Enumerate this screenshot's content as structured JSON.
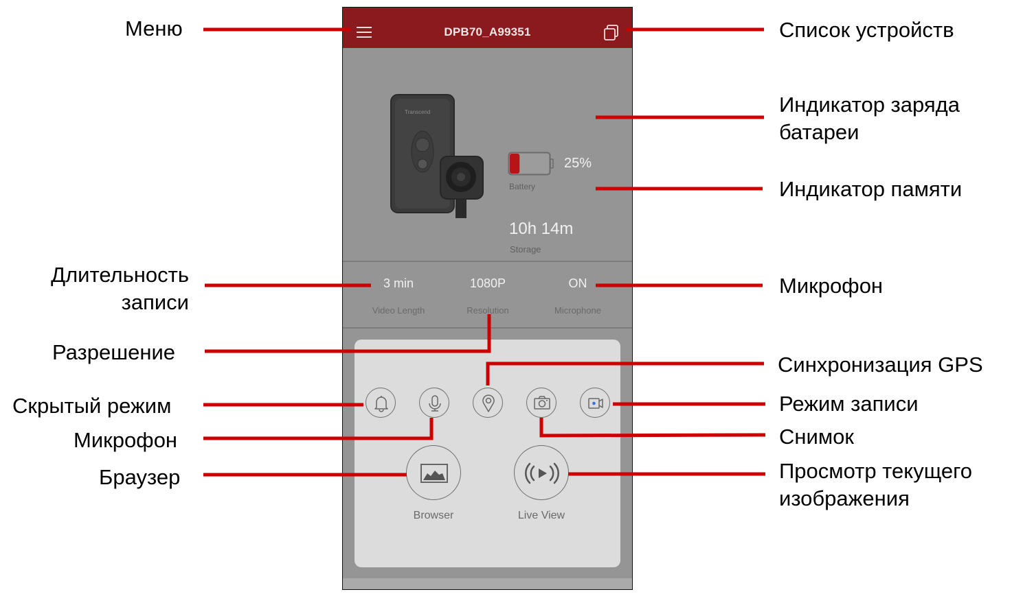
{
  "app": {
    "device_name": "DPB70_A99351",
    "accent_color": "#8b1a1e",
    "menu_icon": "hamburger-menu-icon",
    "device_list_icon": "device-list-icon"
  },
  "status": {
    "battery_percent": 25,
    "battery_text": "25%",
    "battery_label": "Battery",
    "battery_fill_color": "#b81418",
    "storage_value": "10h 14m",
    "storage_label": "Storage"
  },
  "settings": [
    {
      "value": "3 min",
      "label": "Video Length"
    },
    {
      "value": "1080P",
      "label": "Resolution"
    },
    {
      "value": "ON",
      "label": "Microphone"
    }
  ],
  "quick_actions": [
    {
      "icon": "bell-icon",
      "name": "stealth-mode"
    },
    {
      "icon": "microphone-icon",
      "name": "microphone"
    },
    {
      "icon": "location-pin-icon",
      "name": "gps-sync"
    },
    {
      "icon": "camera-icon",
      "name": "snapshot"
    },
    {
      "icon": "video-camera-icon",
      "name": "record-mode"
    }
  ],
  "main_actions": [
    {
      "icon": "image-gallery-icon",
      "label": "Browser"
    },
    {
      "icon": "live-broadcast-icon",
      "label": "Live View"
    }
  ],
  "annotations": {
    "color": "#cc0000",
    "left": {
      "menu": "Меню",
      "video_length_line1": "Длительность",
      "video_length_line2": "записи",
      "resolution": "Разрешение",
      "stealth_mode": "Скрытый режим",
      "microphone": "Микрофон",
      "browser": "Браузер"
    },
    "right": {
      "device_list": "Список устройств",
      "battery_line1": "Индикатор заряда",
      "battery_line2": "батареи",
      "storage": "Индикатор памяти",
      "microphone": "Микрофон",
      "gps_sync": "Синхронизация GPS",
      "record_mode": "Режим записи",
      "snapshot": "Снимок",
      "live_view_line1": "Просмотр текущего",
      "live_view_line2": "изображения"
    }
  }
}
